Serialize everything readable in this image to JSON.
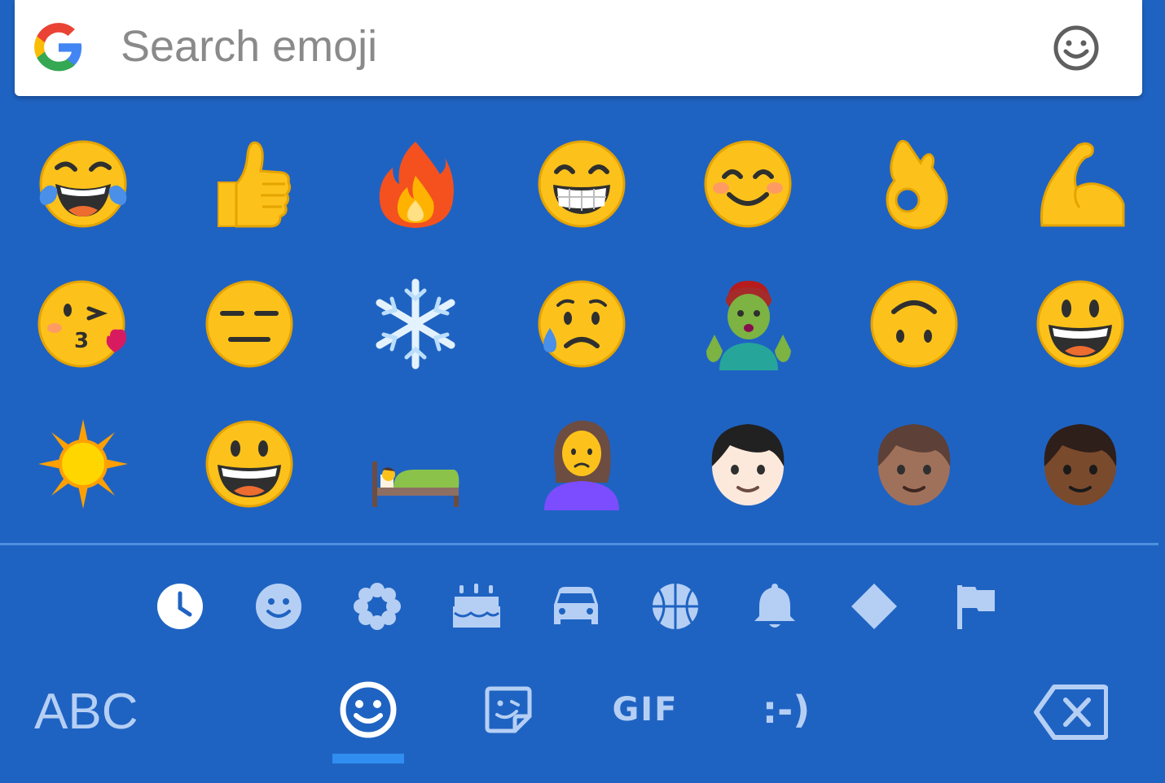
{
  "search": {
    "placeholder": "Search emoji",
    "logo_icon": "google-g-icon",
    "right_icon": "smiley-outline-icon"
  },
  "emoji_rows": [
    [
      "😂",
      "👍",
      "🔥",
      "😁",
      "😊",
      "👌",
      "💪"
    ],
    [
      "😘",
      "😑",
      "❄",
      "😥",
      "🧟",
      "🙃",
      "😃"
    ],
    [
      "☀",
      "😀",
      "🛌",
      "🙎",
      "👦",
      "👦",
      "👦"
    ]
  ],
  "categories": [
    {
      "name": "recent",
      "icon": "clock-icon",
      "active": true
    },
    {
      "name": "smileys",
      "icon": "smiley-icon"
    },
    {
      "name": "nature",
      "icon": "flower-icon"
    },
    {
      "name": "food",
      "icon": "cake-icon"
    },
    {
      "name": "travel",
      "icon": "car-icon"
    },
    {
      "name": "activities",
      "icon": "basketball-icon"
    },
    {
      "name": "objects",
      "icon": "bell-icon"
    },
    {
      "name": "symbols",
      "icon": "diamond-icon"
    },
    {
      "name": "flags",
      "icon": "flag-icon"
    }
  ],
  "bottom": {
    "abc_label": "ABC",
    "gif_label": "GIF",
    "emoticon_label": ":-)"
  },
  "colors": {
    "background": "#1f63c2",
    "icon_inactive": "#b5cff4",
    "active_indicator": "#2f8ef0"
  }
}
